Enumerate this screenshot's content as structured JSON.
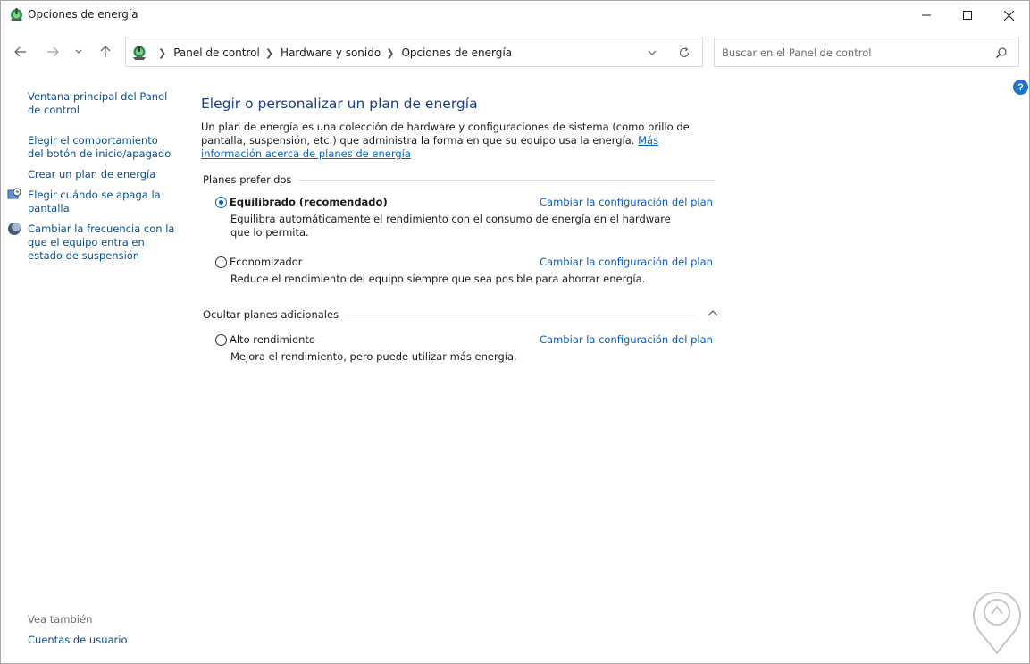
{
  "window": {
    "title": "Opciones de energía"
  },
  "nav": {
    "breadcrumbs": [
      "Panel de control",
      "Hardware y sonido",
      "Opciones de energía"
    ],
    "search_placeholder": "Buscar en el Panel de control"
  },
  "sidebar": {
    "links": [
      "Ventana principal del Panel de control",
      "Elegir el comportamiento del botón de inicio/apagado",
      "Crear un plan de energía",
      "Elegir cuándo se apaga la pantalla",
      "Cambiar la frecuencia con la que el equipo entra en estado de suspensión"
    ],
    "see_also": "Vea también",
    "user_accounts": "Cuentas de usuario"
  },
  "main": {
    "title": "Elegir o personalizar un plan de energía",
    "intro_text": "Un plan de energía es una colección de hardware y configuraciones de sistema (como brillo de pantalla, suspensión, etc.) que administra la forma en que su equipo usa la energía.",
    "intro_link": "Más información acerca de planes de energía",
    "preferred_header": "Planes preferidos",
    "hidden_header": "Ocultar planes adicionales",
    "change_link": "Cambiar la configuración del plan",
    "plans": [
      {
        "name": "Equilibrado (recomendado)",
        "selected": true,
        "description": "Equilibra automáticamente el rendimiento con el consumo de energía en el hardware que lo permita."
      },
      {
        "name": "Economizador",
        "selected": false,
        "description": "Reduce el rendimiento del equipo siempre que sea posible para ahorrar energía."
      },
      {
        "name": "Alto rendimiento",
        "selected": false,
        "description": "Mejora el rendimiento, pero puede utilizar más energía."
      }
    ]
  },
  "colors": {
    "accent": "#0066cc",
    "title": "#183e8f",
    "link": "#0a4c91"
  }
}
